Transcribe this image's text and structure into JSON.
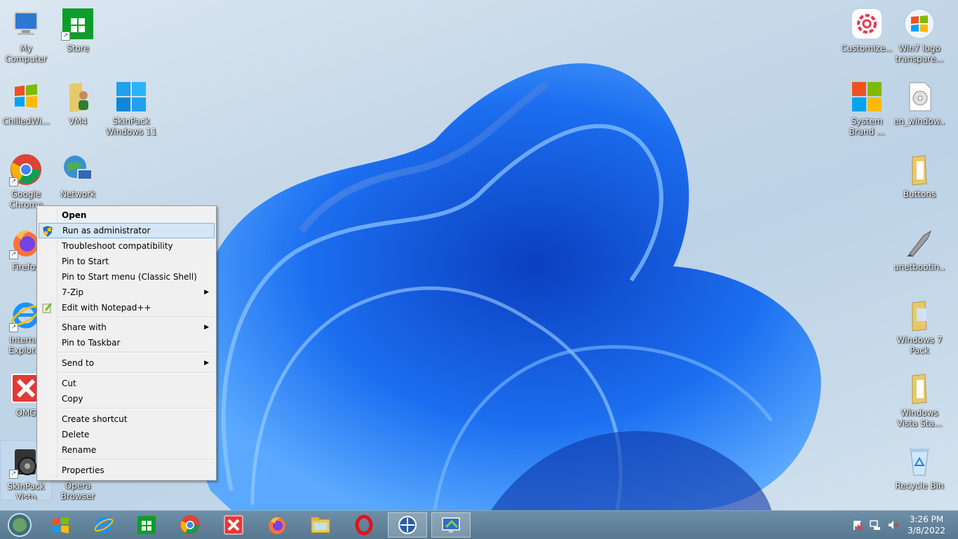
{
  "desktop": {
    "icons_left": [
      {
        "label": "My\nComputer",
        "icon": "computer-icon"
      },
      {
        "label": "Store",
        "icon": "store-icon"
      },
      {
        "label": "ChilledWi...",
        "icon": "windows-flag-icon"
      },
      {
        "label": "VM4",
        "icon": "user-folder-icon"
      },
      {
        "label": "SkinPack\nWindows 11",
        "icon": "windows11-logo-icon"
      },
      {
        "label": "Google\nChrome",
        "icon": "chrome-icon"
      },
      {
        "label": "Network",
        "icon": "network-icon"
      },
      {
        "label": "Firefox",
        "icon": "firefox-icon"
      },
      {
        "label": "Internet\nExplorer",
        "icon": "internet-explorer-icon"
      },
      {
        "label": "OMG",
        "icon": "red-x-icon"
      },
      {
        "label": "SkinPack\nVista",
        "icon": "skinpack-vista-icon"
      },
      {
        "label": "Opera\nBrowser",
        "icon": "opera-icon"
      }
    ],
    "icons_right": [
      {
        "label": "Customize...",
        "icon": "gear-icon"
      },
      {
        "label": "Win7 logo\ntranspare...",
        "icon": "win7-logo-icon"
      },
      {
        "label": "System\nBrand ...",
        "icon": "windows-logo-icon"
      },
      {
        "label": "en_window...",
        "icon": "disc-image-icon"
      },
      {
        "label": "Buttons",
        "icon": "folder-icon"
      },
      {
        "label": "unetbootin...",
        "icon": "usb-rocket-icon"
      },
      {
        "label": "Windows 7\nPack",
        "icon": "folder-icon"
      },
      {
        "label": "Windows\nVista Sta...",
        "icon": "folder-icon"
      },
      {
        "label": "Recycle Bin",
        "icon": "recycle-bin-icon"
      }
    ]
  },
  "context_menu": {
    "open": "Open",
    "run_as_admin": "Run as administrator",
    "troubleshoot": "Troubleshoot compatibility",
    "pin_start": "Pin to Start",
    "pin_start_classic": "Pin to Start menu (Classic Shell)",
    "seven_zip": "7-Zip",
    "edit_notepad": "Edit with Notepad++",
    "share_with": "Share with",
    "pin_taskbar": "Pin to Taskbar",
    "send_to": "Send to",
    "cut": "Cut",
    "copy": "Copy",
    "create_shortcut": "Create shortcut",
    "delete": "Delete",
    "rename": "Rename",
    "properties": "Properties",
    "submenu_arrow": "▶"
  },
  "taskbar": {
    "items": [
      {
        "name": "start-orb-icon"
      },
      {
        "name": "windows-flag-icon"
      },
      {
        "name": "internet-explorer-icon"
      },
      {
        "name": "store-icon"
      },
      {
        "name": "chrome-icon"
      },
      {
        "name": "red-x-icon"
      },
      {
        "name": "firefox-icon"
      },
      {
        "name": "file-explorer-icon"
      },
      {
        "name": "opera-icon"
      },
      {
        "name": "classic-shell-icon"
      },
      {
        "name": "display-settings-icon"
      }
    ],
    "clock": {
      "time": "3:26 PM",
      "date": "3/8/2022"
    }
  },
  "colors": {
    "accent_blue": "#1a6fe0",
    "menu_highlight": "#d5e6f7",
    "taskbar": "#5f7f97"
  }
}
